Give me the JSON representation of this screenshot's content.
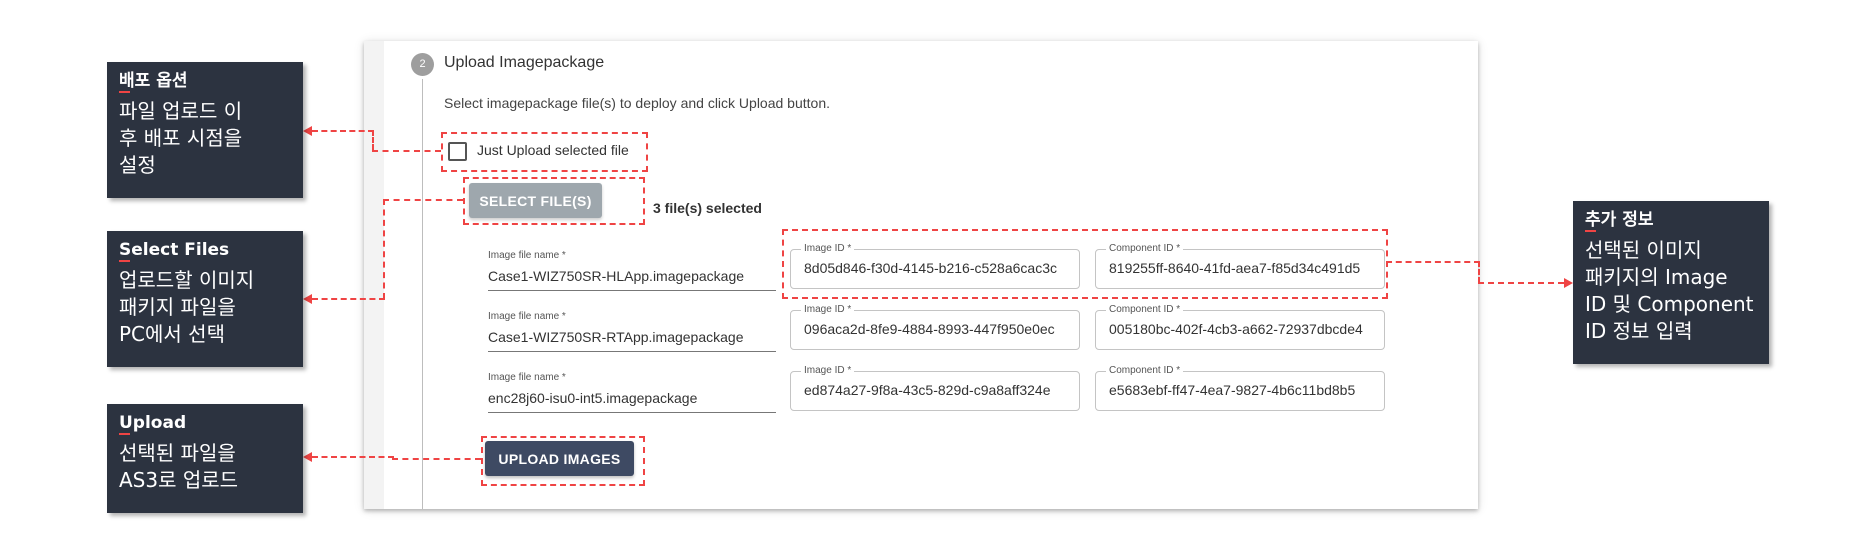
{
  "step": {
    "number": "2",
    "title": "Upload Imagepackage",
    "description": "Select imagepackage file(s) to deploy and click Upload button."
  },
  "checkbox": {
    "label": "Just Upload selected file",
    "checked": false
  },
  "select_button": {
    "label": "SELECT FILE(S)"
  },
  "selected_count": "3 file(s) selected",
  "upload_button": {
    "label": "UPLOAD IMAGES"
  },
  "files": [
    {
      "name_label": "Image file name *",
      "name": "Case1-WIZ750SR-HLApp.imagepackage",
      "image_id_label": "Image ID *",
      "image_id": "8d05d846-f30d-4145-b216-c528a6cac3c",
      "component_id_label": "Component ID *",
      "component_id": "819255ff-8640-41fd-aea7-f85d34c491d5"
    },
    {
      "name_label": "Image file name *",
      "name": "Case1-WIZ750SR-RTApp.imagepackage",
      "image_id_label": "Image ID *",
      "image_id": "096aca2d-8fe9-4884-8993-447f950e0ec",
      "component_id_label": "Component ID *",
      "component_id": "005180bc-402f-4cb3-a662-72937dbcde4"
    },
    {
      "name_label": "Image file name *",
      "name": "enc28j60-isu0-int5.imagepackage",
      "image_id_label": "Image ID *",
      "image_id": "ed874a27-9f8a-43c5-829d-c9a8aff324e",
      "component_id_label": "Component ID *",
      "component_id": "e5683ebf-ff47-4ea7-9827-4b6c11bd8b5"
    }
  ],
  "callouts": {
    "deploy_option": {
      "title": "배포 옵션",
      "body": "파일 업로드 이\n후 배포 시점을\n설정"
    },
    "select_files": {
      "title": "Select Files",
      "body": "업로드할 이미지\n패키지 파일을\nPC에서 선택"
    },
    "upload": {
      "title": "Upload",
      "body": "선택된 파일을\nAS3로 업로드"
    },
    "extra_info": {
      "title": "추가 정보",
      "body": "선택된 이미지\n패키지의 Image\nID 및 Component\nID 정보 입력"
    }
  },
  "colors": {
    "annotation": "#ef4444",
    "callout_bg": "#2c3340",
    "upload_button": "#3e4a63",
    "select_button": "#9ea7ad"
  }
}
